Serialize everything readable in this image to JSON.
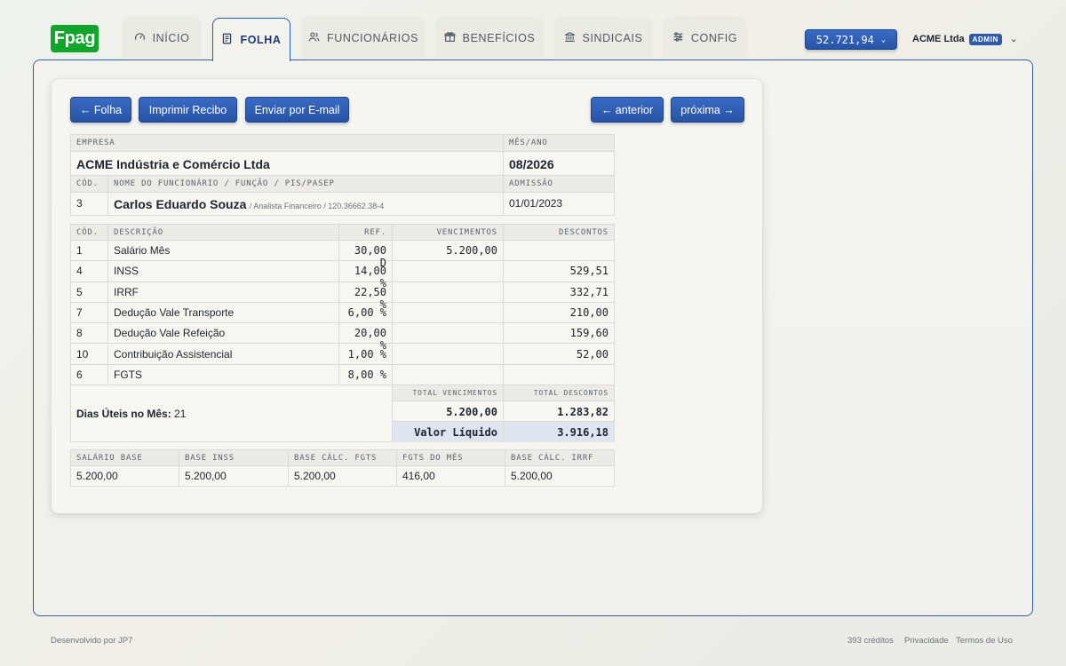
{
  "app": {
    "logo": "Fpag"
  },
  "nav": {
    "tabs": [
      {
        "label": "INÍCIO",
        "icon": "gauge-icon"
      },
      {
        "label": "FOLHA",
        "icon": "document-icon",
        "active": true
      },
      {
        "label": "FUNCIONÁRIOS",
        "icon": "users-icon"
      },
      {
        "label": "BENEFÍCIOS",
        "icon": "gift-icon"
      },
      {
        "label": "SINDICAIS",
        "icon": "bank-icon"
      },
      {
        "label": "CONFIG",
        "icon": "sliders-icon"
      }
    ],
    "balance": "52.721,94",
    "company": "ACME Ltda",
    "role_badge": "ADMIN"
  },
  "toolbar": {
    "back_label": "← Folha",
    "print_label": "Imprimir Recibo",
    "email_label": "Enviar por E-mail",
    "prev_label": "← anterior",
    "next_label": "próxima →"
  },
  "header": {
    "company_label": "EMPRESA",
    "company_value": "ACME Indústria e Comércio Ltda",
    "period_label": "MÊS/ANO",
    "period_value": "08/2026",
    "code_label": "CÓD.",
    "code_value": "3",
    "employee_label": "NOME DO FUNCIONÁRIO / FUNÇÃO / PIS/PASEP",
    "employee_name": "Carlos Eduardo Souza",
    "employee_details": "/ Analista Financeiro / 120.36662.38-4",
    "admission_label": "ADMISSÃO",
    "admission_value": "01/01/2023"
  },
  "items_table": {
    "columns": [
      "CÓD.",
      "DESCRIÇÃO",
      "REF.",
      "VENCIMENTOS",
      "DESCONTOS"
    ],
    "rows": [
      {
        "code": "1",
        "desc": "Salário Mês",
        "ref": "30,00 D",
        "earn": "5.200,00",
        "ded": ""
      },
      {
        "code": "4",
        "desc": "INSS",
        "ref": "14,00 %",
        "earn": "",
        "ded": "529,51"
      },
      {
        "code": "5",
        "desc": "IRRF",
        "ref": "22,50 %",
        "earn": "",
        "ded": "332,71"
      },
      {
        "code": "7",
        "desc": "Dedução Vale Transporte",
        "ref": "6,00 %",
        "earn": "",
        "ded": "210,00"
      },
      {
        "code": "8",
        "desc": "Dedução Vale Refeição",
        "ref": "20,00 %",
        "earn": "",
        "ded": "159,60"
      },
      {
        "code": "10",
        "desc": "Contribuição Assistencial",
        "ref": "1,00 %",
        "earn": "",
        "ded": "52,00"
      },
      {
        "code": "6",
        "desc": "FGTS",
        "ref": "8,00 %",
        "earn": "",
        "ded": ""
      }
    ],
    "workdays_label": "Dias Úteis no Mês:",
    "workdays_value": "21",
    "total_earn_label": "TOTAL VENCIMENTOS",
    "total_ded_label": "TOTAL DESCONTOS",
    "total_earn": "5.200,00",
    "total_ded": "1.283,82",
    "net_label": "Valor Líquido",
    "net_value": "3.916,18"
  },
  "bases": {
    "columns": [
      "SALÁRIO BASE",
      "BASE INSS",
      "BASE CÁLC. FGTS",
      "FGTS DO MÊS",
      "BASE CÁLC. IRRF"
    ],
    "values": [
      "5.200,00",
      "5.200,00",
      "5.200,00",
      "416,00",
      "5.200,00"
    ]
  },
  "footer": {
    "credit": "Desenvolvido por JP7",
    "credits": "393 créditos",
    "privacy": "Privacidade",
    "terms": "Termos de Uso"
  }
}
